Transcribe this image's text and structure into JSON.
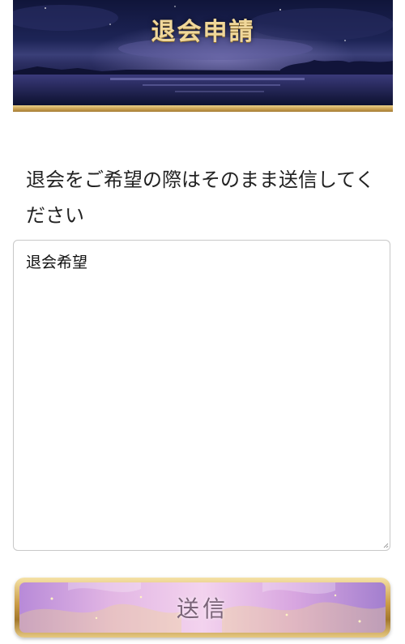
{
  "header": {
    "title": "退会申請"
  },
  "form": {
    "instruction": "退会をご希望の際はそのまま送信してください",
    "message_value": "退会希望",
    "submit_label": "送信"
  },
  "colors": {
    "banner_dark": "#10153a",
    "gold": "#c79d4d",
    "title_gold": "#f0d79a",
    "button_purple": "#d8a6e0",
    "button_text": "#7a6478"
  }
}
